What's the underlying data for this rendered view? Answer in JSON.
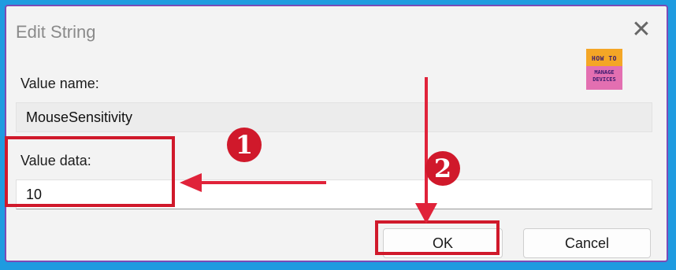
{
  "dialog": {
    "title": "Edit String",
    "close_icon": "close-icon",
    "value_name_label": "Value name:",
    "value_name": "MouseSensitivity",
    "value_data_label": "Value data:",
    "value_data": "10",
    "ok_label": "OK",
    "cancel_label": "Cancel"
  },
  "annotations": {
    "step1": "1",
    "step2": "2",
    "color": "#d0192b"
  },
  "logo": {
    "line1": "HOW TO",
    "line2": "MANAGE DEVICES"
  },
  "colors": {
    "outer_background": "#1f9be0",
    "frame_border": "#7b4ab5",
    "dialog_background": "#f3f3f3",
    "logo_orange": "#f4a626",
    "logo_pink": "#e36fb1"
  }
}
